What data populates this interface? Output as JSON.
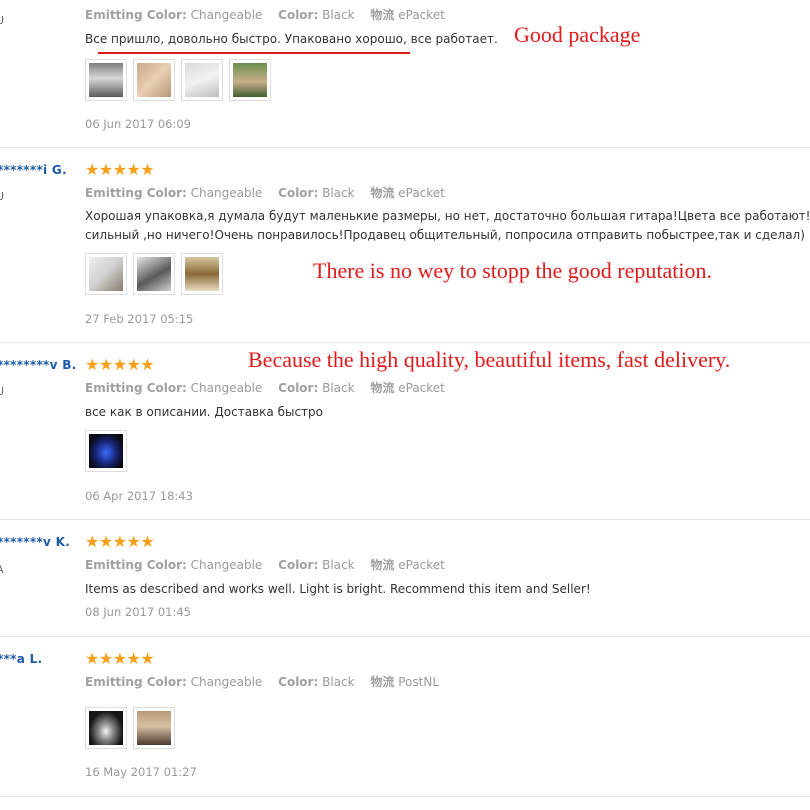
{
  "attr_labels": {
    "emitting_color": "Emitting Color:",
    "color": "Color:",
    "shipping": "物流"
  },
  "colors": {
    "star": "#f6a01a",
    "username": "#1a5aa8",
    "annotation": "#e21a1a"
  },
  "reviews": [
    {
      "name": "",
      "country": "U",
      "stars": "★★★★★",
      "star_count": 5,
      "emitting_color": "Changeable",
      "color": "Black",
      "shipping": "ePacket",
      "feedback": "Все пришло, довольно быстро. Упаковано хорошо, все работает.",
      "photos": 4,
      "date": "06 Jun 2017 06:09"
    },
    {
      "name": "*******i G.",
      "country": "U",
      "stars": "★★★★★",
      "star_count": 5,
      "emitting_color": "Changeable",
      "color": "Black",
      "shipping": "ePacket",
      "feedback_line1": "Хорошая упаковка,я думала будут маленькие размеры, но нет, достаточно большая гитара!Цвета все работают! Зап",
      "feedback_line2": "сильный ,но ничего!Очень понравилось!Продавец общительный, попросила отправить побыстрее,так и сделал)",
      "photos": 3,
      "date": "27 Feb 2017 05:15"
    },
    {
      "name": "********v B.",
      "country": "U",
      "stars": "★★★★★",
      "star_count": 5,
      "emitting_color": "Changeable",
      "color": "Black",
      "shipping": "ePacket",
      "feedback": "все как в описании. Доставка быстро",
      "photos": 1,
      "date": "06 Apr 2017 18:43"
    },
    {
      "name": "*******v K.",
      "country": "A",
      "stars": "★★★★★",
      "star_count": 5,
      "emitting_color": "Changeable",
      "color": "Black",
      "shipping": "ePacket",
      "feedback": "Items as described and works well. Light is bright. Recommend this item and Seller!",
      "photos": 0,
      "date": "08 Jun 2017 01:45"
    },
    {
      "name": "***a L.",
      "country": "",
      "stars": "★★★★★",
      "star_count": 5,
      "emitting_color": "Changeable",
      "color": "Black",
      "shipping": "PostNL",
      "feedback": "",
      "photos": 2,
      "date": "16 May 2017 01:27"
    }
  ],
  "annotations": {
    "good_package": "Good package",
    "reputation": "There is no wey to stopp the good reputation.",
    "quality": "Because the high quality, beautiful items, fast delivery."
  }
}
